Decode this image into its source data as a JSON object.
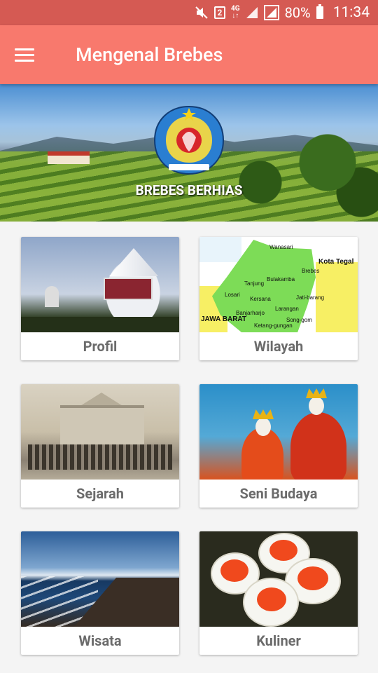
{
  "status_bar": {
    "network": "4G",
    "sim": "2",
    "battery": "80%",
    "time": "11:34",
    "icons": [
      "mute-icon",
      "sim-icon",
      "4g-icon",
      "signal-icon",
      "signal-2-icon",
      "battery-icon"
    ]
  },
  "app_bar": {
    "title": "Mengenal Brebes",
    "menu_icon": "menu-icon"
  },
  "banner": {
    "caption": "BREBES BERHIAS",
    "emblem_text": "KABUPATEN BREBES"
  },
  "menu": [
    {
      "label": "Profil"
    },
    {
      "label": "Wilayah"
    },
    {
      "label": "Sejarah"
    },
    {
      "label": "Seni Budaya"
    },
    {
      "label": "Wisata"
    },
    {
      "label": "Kuliner"
    }
  ],
  "map_labels": {
    "north": "Wanasari",
    "city": "Kota Tegal",
    "brebes": "Brebes",
    "tanjung": "Tanjung",
    "bulakamba": "Bulakamba",
    "losari": "Losari",
    "kersana": "Kersana",
    "jatibarang": "Jati-barang",
    "larangan": "Larangan",
    "banjarharjo": "Banjarharjo",
    "ketanggungan": "Ketang-gungan",
    "songgom": "Song-gom",
    "west": "JAWA BARAT"
  },
  "colors": {
    "status_bar": "#d55a53",
    "app_bar": "#f8796d",
    "background": "#f4f4f4",
    "card_label": "#6b6b6b"
  }
}
